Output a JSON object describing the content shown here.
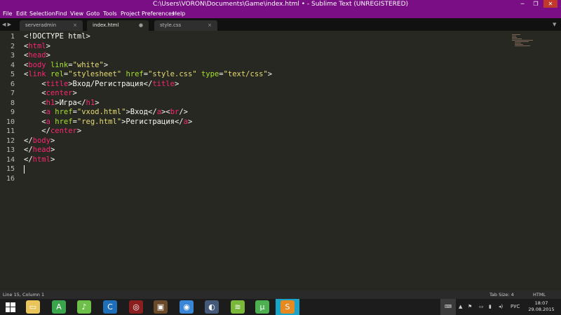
{
  "window": {
    "title": "C:\\Users\\VORON\\Documents\\Game\\index.html • - Sublime Text (UNREGISTERED)",
    "controls": {
      "minimize": "─",
      "maximize": "❐",
      "close": "✕"
    },
    "accent_color": "#7a0f85"
  },
  "menu": [
    "File",
    "Edit",
    "Selection",
    "Find",
    "View",
    "Goto",
    "Tools",
    "Project",
    "Preferences",
    "Help"
  ],
  "tabs": {
    "nav_left": "◀ ▶",
    "nav_right": "▼",
    "items": [
      {
        "label": "serveradmin",
        "close": "×",
        "active": false
      },
      {
        "label": "index.html",
        "close": "●",
        "active": true
      },
      {
        "label": "style.css",
        "close": "×",
        "active": false
      }
    ]
  },
  "editor": {
    "line_numbers": [
      "1",
      "2",
      "3",
      "4",
      "5",
      "6",
      "7",
      "8",
      "9",
      "10",
      "11",
      "12",
      "13",
      "14",
      "15",
      "16"
    ],
    "lines": [
      [
        {
          "t": "txt",
          "v": "<!DOCTYPE html>"
        }
      ],
      [
        {
          "t": "txt",
          "v": "<"
        },
        {
          "t": "tag",
          "v": "html"
        },
        {
          "t": "txt",
          "v": ">"
        }
      ],
      [
        {
          "t": "txt",
          "v": "<"
        },
        {
          "t": "tag",
          "v": "head"
        },
        {
          "t": "txt",
          "v": ">"
        }
      ],
      [
        {
          "t": "txt",
          "v": "<"
        },
        {
          "t": "tag",
          "v": "body"
        },
        {
          "t": "txt",
          "v": " "
        },
        {
          "t": "attr",
          "v": "link"
        },
        {
          "t": "txt",
          "v": "="
        },
        {
          "t": "str",
          "v": "\"white\""
        },
        {
          "t": "txt",
          "v": ">"
        }
      ],
      [
        {
          "t": "txt",
          "v": "<"
        },
        {
          "t": "tag",
          "v": "link"
        },
        {
          "t": "txt",
          "v": " "
        },
        {
          "t": "attr",
          "v": "rel"
        },
        {
          "t": "txt",
          "v": "="
        },
        {
          "t": "str",
          "v": "\"stylesheet\""
        },
        {
          "t": "txt",
          "v": " "
        },
        {
          "t": "attr",
          "v": "href"
        },
        {
          "t": "txt",
          "v": "="
        },
        {
          "t": "str",
          "v": "\"style.css\""
        },
        {
          "t": "txt",
          "v": " "
        },
        {
          "t": "attr",
          "v": "type"
        },
        {
          "t": "txt",
          "v": "="
        },
        {
          "t": "str",
          "v": "\"text/css\""
        },
        {
          "t": "txt",
          "v": ">"
        }
      ],
      [
        {
          "t": "txt",
          "v": "    <"
        },
        {
          "t": "tag",
          "v": "title"
        },
        {
          "t": "txt",
          "v": ">Вход/Регистрация</"
        },
        {
          "t": "tag",
          "v": "title"
        },
        {
          "t": "txt",
          "v": ">"
        }
      ],
      [
        {
          "t": "txt",
          "v": "    <"
        },
        {
          "t": "tag",
          "v": "center"
        },
        {
          "t": "txt",
          "v": ">"
        }
      ],
      [
        {
          "t": "txt",
          "v": "    <"
        },
        {
          "t": "tag",
          "v": "h1"
        },
        {
          "t": "txt",
          "v": ">Игра</"
        },
        {
          "t": "tag",
          "v": "h1"
        },
        {
          "t": "txt",
          "v": ">"
        }
      ],
      [
        {
          "t": "txt",
          "v": "    <"
        },
        {
          "t": "tag",
          "v": "a"
        },
        {
          "t": "txt",
          "v": " "
        },
        {
          "t": "attr",
          "v": "href"
        },
        {
          "t": "txt",
          "v": "="
        },
        {
          "t": "str",
          "v": "\"vxod.html\""
        },
        {
          "t": "txt",
          "v": ">Вход</"
        },
        {
          "t": "tag",
          "v": "a"
        },
        {
          "t": "txt",
          "v": "><"
        },
        {
          "t": "tag",
          "v": "br"
        },
        {
          "t": "txt",
          "v": "/>"
        }
      ],
      [
        {
          "t": "txt",
          "v": "    <"
        },
        {
          "t": "tag",
          "v": "a"
        },
        {
          "t": "txt",
          "v": " "
        },
        {
          "t": "attr",
          "v": "href"
        },
        {
          "t": "txt",
          "v": "="
        },
        {
          "t": "str",
          "v": "\"reg.html\""
        },
        {
          "t": "txt",
          "v": ">Регистрация</"
        },
        {
          "t": "tag",
          "v": "a"
        },
        {
          "t": "txt",
          "v": ">"
        }
      ],
      [
        {
          "t": "txt",
          "v": "    </"
        },
        {
          "t": "tag",
          "v": "center"
        },
        {
          "t": "txt",
          "v": ">"
        }
      ],
      [
        {
          "t": "txt",
          "v": "</"
        },
        {
          "t": "tag",
          "v": "body"
        },
        {
          "t": "txt",
          "v": ">"
        }
      ],
      [
        {
          "t": "txt",
          "v": "</"
        },
        {
          "t": "tag",
          "v": "head"
        },
        {
          "t": "txt",
          "v": ">"
        }
      ],
      [
        {
          "t": "txt",
          "v": "</"
        },
        {
          "t": "tag",
          "v": "html"
        },
        {
          "t": "txt",
          "v": ">"
        }
      ],
      [],
      []
    ],
    "cursor_line": 15,
    "colors": {
      "background": "#272822",
      "tag": "#f92672",
      "attribute": "#a6e22e",
      "string": "#e6db74",
      "text": "#f8f8f2"
    }
  },
  "status": {
    "position": "Line 15, Column 1",
    "tab_size": "Tab Size: 4",
    "syntax": "HTML"
  },
  "taskbar": {
    "start_icon": "windows-start-icon",
    "apps": [
      {
        "name": "file-explorer-icon",
        "glyph": "▭",
        "color": "#e8c45a"
      },
      {
        "name": "android-studio-icon",
        "glyph": "A",
        "color": "#3aa54a"
      },
      {
        "name": "music-app-icon",
        "glyph": "♪",
        "color": "#6cc04a"
      },
      {
        "name": "browser-c-icon",
        "glyph": "C",
        "color": "#1f6fb8"
      },
      {
        "name": "target-app-icon",
        "glyph": "◎",
        "color": "#8b1e1e"
      },
      {
        "name": "box-app-icon",
        "glyph": "▣",
        "color": "#6b4a2a"
      },
      {
        "name": "network-globe-icon",
        "glyph": "◉",
        "color": "#3a86d6"
      },
      {
        "name": "media-app-icon",
        "glyph": "◐",
        "color": "#455a7a"
      },
      {
        "name": "bluestacks-icon",
        "glyph": "≋",
        "color": "#7ab83a"
      },
      {
        "name": "utorrent-icon",
        "glyph": "µ",
        "color": "#4caf50"
      },
      {
        "name": "sublime-text-icon",
        "glyph": "S",
        "color": "#e68a1f"
      }
    ],
    "tray_language": "РУС",
    "time": "18:07",
    "date": "29.08.2015"
  }
}
